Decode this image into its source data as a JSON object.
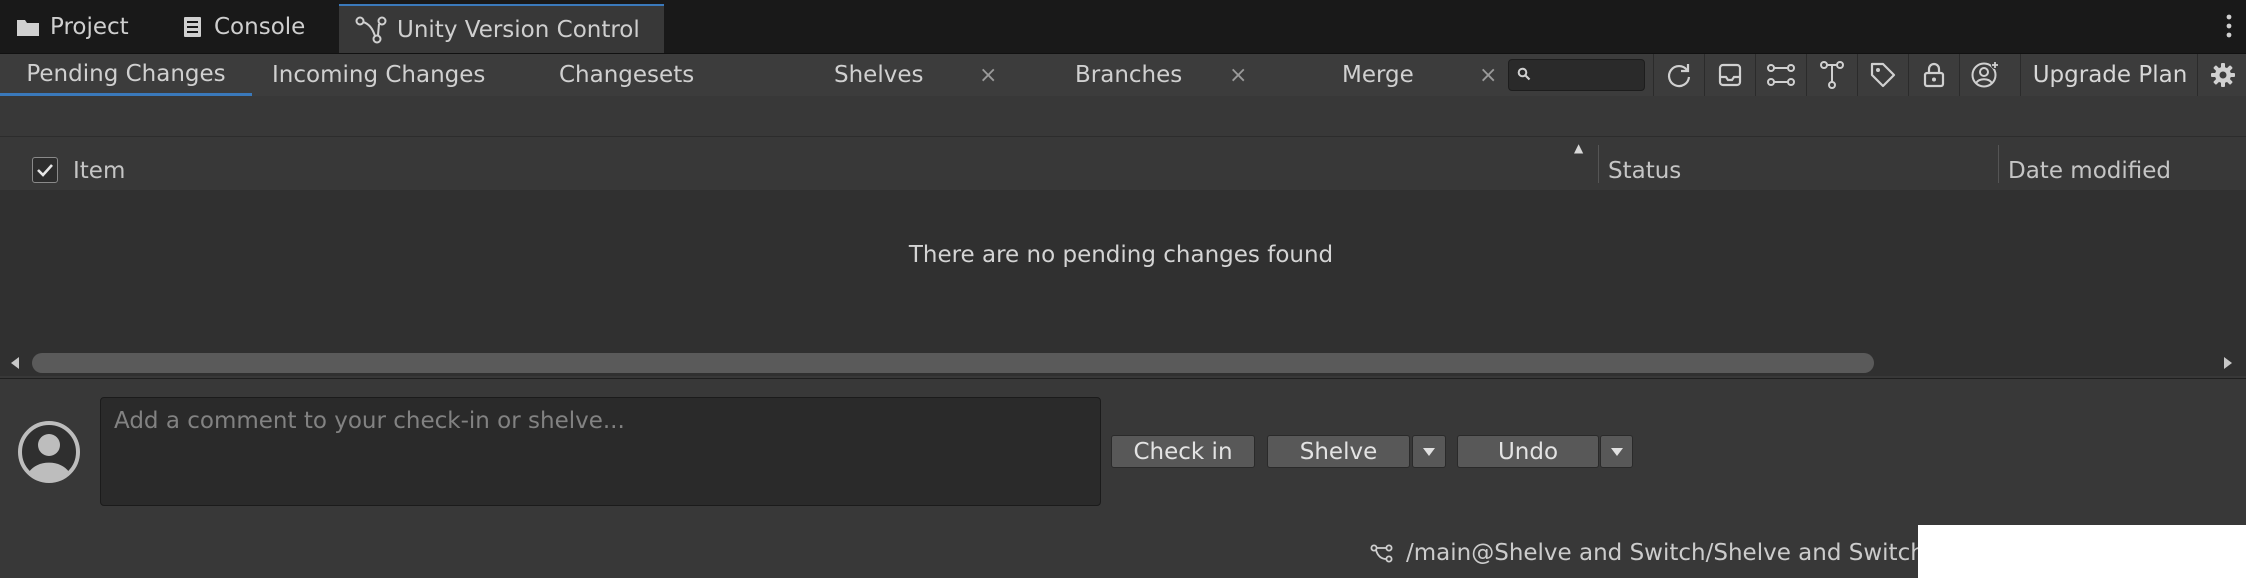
{
  "window_tabs": [
    {
      "label": "Project",
      "icon": "folder-icon"
    },
    {
      "label": "Console",
      "icon": "console-icon"
    },
    {
      "label": "Unity Version Control",
      "icon": "version-control-icon",
      "active": true
    }
  ],
  "sub_tabs": [
    {
      "label": "Pending Changes",
      "active": true
    },
    {
      "label": "Incoming Changes"
    },
    {
      "label": "Changesets"
    },
    {
      "label": "Shelves",
      "closable": true
    },
    {
      "label": "Branches",
      "closable": true
    },
    {
      "label": "Merge",
      "closable": true
    }
  ],
  "close_glyph": "×",
  "search": {
    "value": "",
    "placeholder": ""
  },
  "toolbar_icons": [
    "refresh-icon",
    "inbox-icon",
    "branches-icon",
    "branch-explorer-icon",
    "labels-icon",
    "lock-icon",
    "user-settings-icon"
  ],
  "toolbar": {
    "upgrade_label": "Upgrade Plan"
  },
  "table": {
    "columns": [
      "Item",
      "Status",
      "Date modified"
    ],
    "select_all_checked": true,
    "sort_indicator": "▲",
    "empty_message": "There are no pending changes found"
  },
  "comment": {
    "placeholder": "Add a comment to your check-in or shelve...",
    "value": ""
  },
  "buttons": {
    "checkin": "Check in",
    "shelve": "Shelve",
    "undo": "Undo"
  },
  "status_bar": {
    "branch_path": "/main@Shelve and Switch/Shelve and Switch"
  },
  "colors": {
    "accent": "#3a79bb",
    "background": "#383838",
    "tab_strip": "#191919"
  }
}
